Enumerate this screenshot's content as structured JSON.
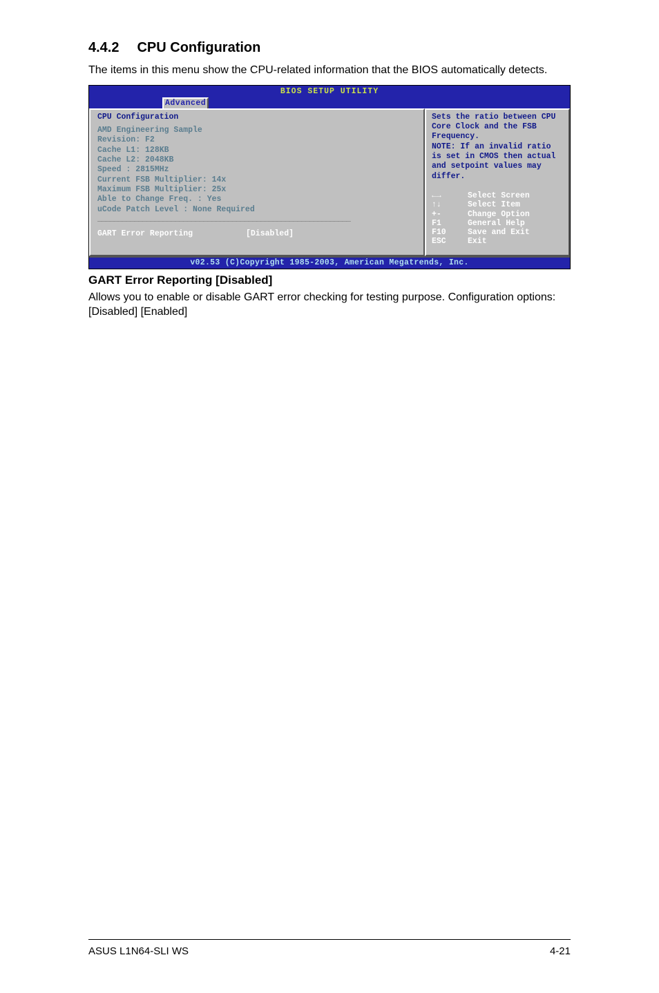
{
  "section": {
    "number": "4.4.2",
    "title": "CPU Configuration"
  },
  "intro": "The items in this menu show the CPU-related information that the BIOS automatically detects.",
  "bios": {
    "header_title": "BIOS SETUP UTILITY",
    "tab": "Advanced",
    "panel_title": "CPU Configuration",
    "info_lines": [
      "AMD Engineering Sample",
      "Revision: F2",
      "Cache L1: 128KB",
      "Cache L2: 2048KB",
      "Speed   : 2815MHz",
      "Current FSB Multiplier: 14x",
      "Maximum FSB Multiplier: 25x",
      "Able to Change Freq.  : Yes",
      "uCode Patch Level     : None Required"
    ],
    "setting": {
      "label": "GART Error Reporting",
      "value": "[Disabled]"
    },
    "help": "Sets the ratio between CPU Core Clock and the FSB Frequency.\nNOTE: If an invalid ratio is set in CMOS then actual and setpoint values may differ.",
    "nav": [
      {
        "key": "←→",
        "action": "Select Screen"
      },
      {
        "key": "↑↓",
        "action": "Select Item"
      },
      {
        "key": "+-",
        "action": "Change Option"
      },
      {
        "key": "F1",
        "action": "General Help"
      },
      {
        "key": "F10",
        "action": "Save and Exit"
      },
      {
        "key": "ESC",
        "action": "Exit"
      }
    ],
    "footer": "v02.53 (C)Copyright 1985-2003, American Megatrends, Inc."
  },
  "sub": {
    "heading": "GART Error Reporting [Disabled]",
    "text": "Allows you to enable or disable GART error checking for testing purpose. Configuration options: [Disabled] [Enabled]"
  },
  "footer": {
    "left": "ASUS L1N64-SLI WS",
    "right": "4-21"
  }
}
